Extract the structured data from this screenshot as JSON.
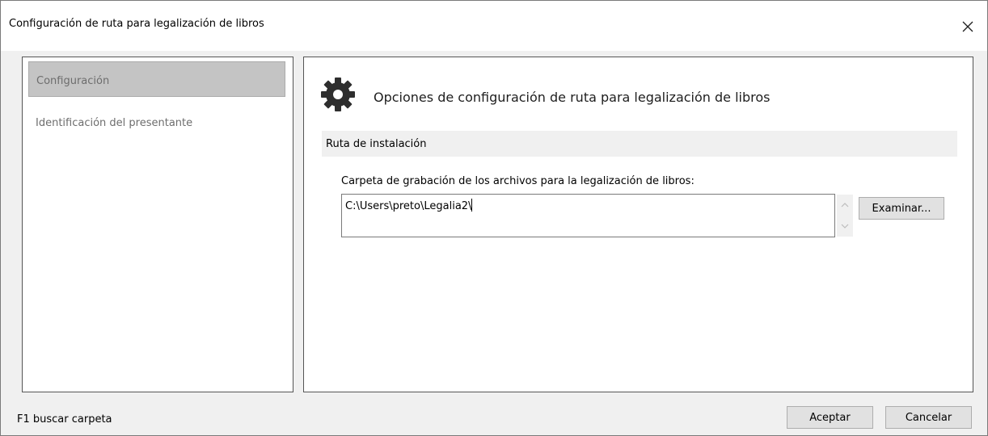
{
  "window": {
    "title": "Configuración de ruta para legalización de libros",
    "close_icon": "close-icon"
  },
  "nav": {
    "items": [
      {
        "label": "Configuración",
        "selected": true
      },
      {
        "label": "Identificación del presentante",
        "selected": false
      }
    ]
  },
  "content": {
    "icon": "gear-icon",
    "heading": "Opciones de configuración de ruta para legalización de libros",
    "section_title": "Ruta de instalación",
    "field_label": "Carpeta de grabación de los archivos para la legalización de libros:",
    "path_value": "C:\\Users\\preto\\Legalia2\\",
    "browse_label": "Examinar..."
  },
  "footer": {
    "status": "F1 buscar carpeta",
    "ok_label": "Aceptar",
    "cancel_label": "Cancelar"
  },
  "colors": {
    "selected_bg": "#c4c4c4",
    "panel_border": "#555555",
    "window_bg": "#f0f0f0"
  }
}
